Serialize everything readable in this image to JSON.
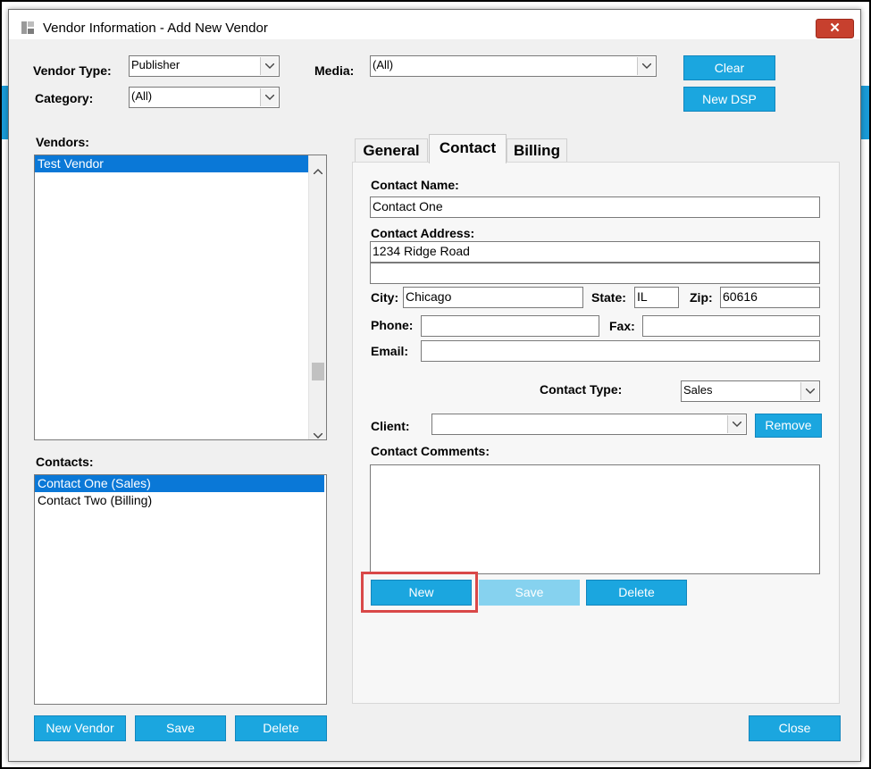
{
  "window": {
    "title": "Vendor Information - Add New Vendor",
    "close_glyph": "✕"
  },
  "filters": {
    "vendor_type_label": "Vendor Type:",
    "vendor_type_value": "Publisher",
    "category_label": "Category:",
    "category_value": "(All)",
    "media_label": "Media:",
    "media_value": "(All)",
    "clear_label": "Clear",
    "new_dsp_label": "New DSP"
  },
  "vendors": {
    "label": "Vendors:",
    "items": [
      "Test Vendor"
    ],
    "selected_index": 0
  },
  "contacts": {
    "label": "Contacts:",
    "items": [
      "Contact One (Sales)",
      "Contact Two (Billing)"
    ],
    "selected_index": 0
  },
  "bottom_buttons": {
    "new_vendor": "New Vendor",
    "save": "Save",
    "delete": "Delete",
    "close": "Close"
  },
  "tabs": [
    {
      "label": "General",
      "active": false
    },
    {
      "label": "Contact",
      "active": true
    },
    {
      "label": "Billing",
      "active": false
    }
  ],
  "contact_form": {
    "name_label": "Contact Name:",
    "name_value": "Contact One",
    "address_label": "Contact Address:",
    "address_line1": "1234 Ridge Road",
    "address_line2": "",
    "city_label": "City:",
    "city_value": "Chicago",
    "state_label": "State:",
    "state_value": "IL",
    "zip_label": "Zip:",
    "zip_value": "60616",
    "phone_label": "Phone:",
    "phone_value": "",
    "fax_label": "Fax:",
    "fax_value": "",
    "email_label": "Email:",
    "email_value": "",
    "contact_type_label": "Contact Type:",
    "contact_type_value": "Sales",
    "client_label": "Client:",
    "client_value": "",
    "remove_label": "Remove",
    "comments_label": "Contact Comments:",
    "comments_value": "",
    "new_label": "New",
    "save_label": "Save",
    "delete_label": "Delete"
  },
  "colors": {
    "accent_blue": "#1ba6df",
    "disabled_blue": "#86d2ef",
    "selection_blue": "#0a78d7",
    "close_red": "#c7402e",
    "highlight_red": "#d94848"
  }
}
